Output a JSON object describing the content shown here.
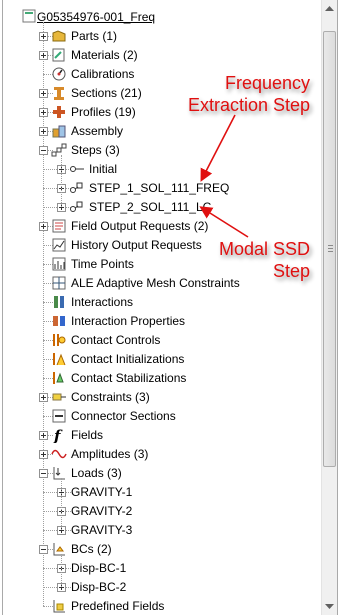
{
  "tree": {
    "root": {
      "label": "G05354976-001_Freq",
      "icon": "model-icon"
    },
    "items": [
      {
        "label": "Parts (1)",
        "icon": "parts-icon",
        "expander": "plus"
      },
      {
        "label": "Materials (2)",
        "icon": "materials-icon",
        "expander": "plus"
      },
      {
        "label": "Calibrations",
        "icon": "calibrations-icon",
        "expander": "none"
      },
      {
        "label": "Sections (21)",
        "icon": "sections-icon",
        "expander": "plus"
      },
      {
        "label": "Profiles (19)",
        "icon": "profiles-icon",
        "expander": "plus"
      },
      {
        "label": "Assembly",
        "icon": "assembly-icon",
        "expander": "plus"
      },
      {
        "label": "Steps (3)",
        "icon": "steps-icon",
        "expander": "minus"
      },
      {
        "label": "Initial",
        "icon": "initial-step-icon",
        "expander": "plus",
        "child": true
      },
      {
        "label": "STEP_1_SOL_111_FREQ",
        "icon": "step-icon",
        "expander": "plus",
        "child": true
      },
      {
        "label": "STEP_2_SOL_111_LC",
        "icon": "step-icon",
        "expander": "plus",
        "child": true
      },
      {
        "label": "Field Output Requests (2)",
        "icon": "field-output-icon",
        "expander": "plus"
      },
      {
        "label": "History Output Requests",
        "icon": "history-output-icon",
        "expander": "none"
      },
      {
        "label": "Time Points",
        "icon": "time-points-icon",
        "expander": "none"
      },
      {
        "label": "ALE Adaptive Mesh Constraints",
        "icon": "ale-mesh-icon",
        "expander": "none"
      },
      {
        "label": "Interactions",
        "icon": "interactions-icon",
        "expander": "none"
      },
      {
        "label": "Interaction Properties",
        "icon": "interaction-properties-icon",
        "expander": "none"
      },
      {
        "label": "Contact Controls",
        "icon": "contact-controls-icon",
        "expander": "none"
      },
      {
        "label": "Contact Initializations",
        "icon": "contact-initializations-icon",
        "expander": "none"
      },
      {
        "label": "Contact Stabilizations",
        "icon": "contact-stabilizations-icon",
        "expander": "none"
      },
      {
        "label": "Constraints (3)",
        "icon": "constraints-icon",
        "expander": "plus"
      },
      {
        "label": "Connector Sections",
        "icon": "connector-sections-icon",
        "expander": "none"
      },
      {
        "label": "Fields",
        "icon": "fields-icon",
        "expander": "plus"
      },
      {
        "label": "Amplitudes (3)",
        "icon": "amplitudes-icon",
        "expander": "plus"
      },
      {
        "label": "Loads (3)",
        "icon": "loads-icon",
        "expander": "minus"
      },
      {
        "label": "GRAVITY-1",
        "icon": "none",
        "expander": "plus",
        "child": true
      },
      {
        "label": "GRAVITY-2",
        "icon": "none",
        "expander": "plus",
        "child": true
      },
      {
        "label": "GRAVITY-3",
        "icon": "none",
        "expander": "plus",
        "child": true
      },
      {
        "label": "BCs (2)",
        "icon": "bcs-icon",
        "expander": "minus"
      },
      {
        "label": "Disp-BC-1",
        "icon": "none",
        "expander": "plus",
        "child": true
      },
      {
        "label": "Disp-BC-2",
        "icon": "none",
        "expander": "plus",
        "child": true
      },
      {
        "label": "Predefined Fields",
        "icon": "predefined-fields-icon",
        "expander": "none"
      }
    ]
  },
  "annotations": {
    "frequency_step": {
      "line1": "Frequency",
      "line2": "Extraction Step"
    },
    "modal_step": {
      "line1": "Modal SSD",
      "line2": "Step"
    }
  },
  "colors": {
    "annotation": "#e01010",
    "tree_line": "#a0a0a0"
  }
}
